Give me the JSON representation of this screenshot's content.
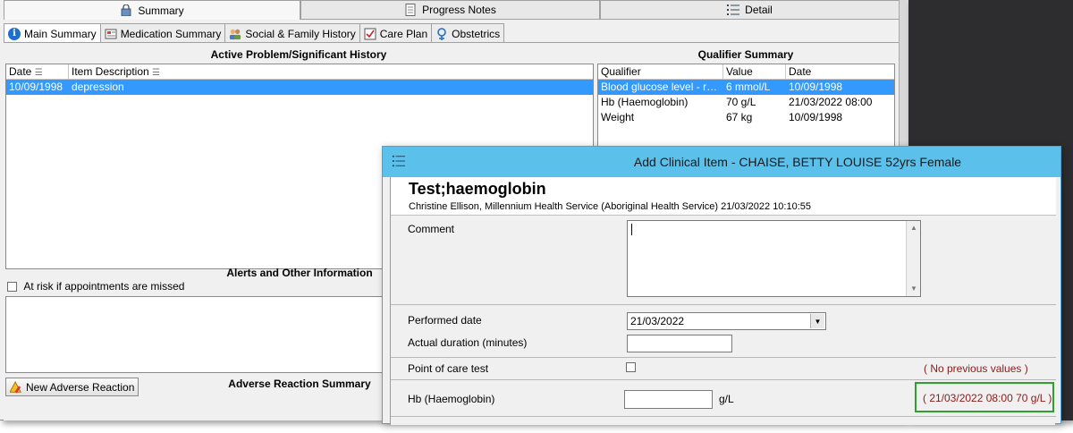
{
  "top_tabs": [
    {
      "label": "Summary",
      "icon": "lock-icon"
    },
    {
      "label": "Progress Notes",
      "icon": "document-icon"
    },
    {
      "label": "Detail",
      "icon": "list-icon"
    }
  ],
  "sub_tabs": [
    {
      "label": "Main Summary",
      "icon": "info-icon"
    },
    {
      "label": "Medication Summary",
      "icon": "medication-icon"
    },
    {
      "label": "Social & Family History",
      "icon": "family-icon"
    },
    {
      "label": "Care Plan",
      "icon": "care-plan-icon"
    },
    {
      "label": "Obstetrics",
      "icon": "female-icon"
    }
  ],
  "active_problem": {
    "title": "Active Problem/Significant History",
    "columns": [
      "Date",
      "Item Description"
    ],
    "rows": [
      {
        "date": "10/09/1998",
        "description": "depression"
      }
    ]
  },
  "qualifier_summary": {
    "title": "Qualifier Summary",
    "columns": [
      "Qualifier",
      "Value",
      "Date"
    ],
    "rows": [
      {
        "qualifier": "Blood glucose level - rand...",
        "value": "6 mmol/L",
        "date": "10/09/1998"
      },
      {
        "qualifier": "Hb (Haemoglobin)",
        "value": "70 g/L",
        "date": "21/03/2022 08:00"
      },
      {
        "qualifier": "Weight",
        "value": "67 kg",
        "date": "10/09/1998"
      }
    ]
  },
  "alerts": {
    "title": "Alerts and Other Information",
    "checkbox_label": "At risk if appointments are missed"
  },
  "adverse": {
    "title": "Adverse Reaction Summary",
    "button_label": "New Adverse Reaction"
  },
  "dialog": {
    "title": "Add Clinical Item - CHAISE, BETTY LOUISE 52yrs Female",
    "heading": "Test;haemoglobin",
    "subheading": "Christine Ellison, Millennium Health Service (Aboriginal Health Service) 21/03/2022 10:10:55",
    "comment_label": "Comment",
    "comment_value": "",
    "performed_date_label": "Performed date",
    "performed_date_value": "21/03/2022",
    "duration_label": "Actual duration (minutes)",
    "duration_value": "",
    "poc_label": "Point of care test",
    "poc_previous": "( No previous values )",
    "hb_label": "Hb (Haemoglobin)",
    "hb_value": "",
    "hb_unit": "g/L",
    "hb_previous": "( 21/03/2022 08:00  70 g/L )"
  },
  "colors": {
    "selection": "#3399ff",
    "dialog_title_bar": "#5bc0ea",
    "previous_text": "#8b1a1a",
    "highlight_box": "#2ea02e"
  }
}
